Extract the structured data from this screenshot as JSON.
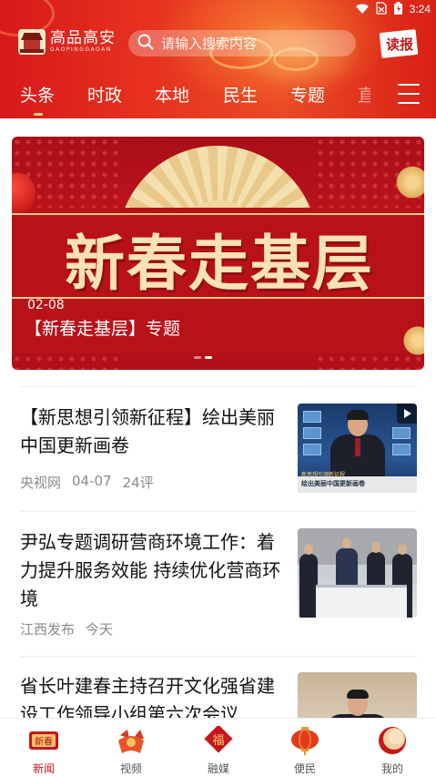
{
  "status_bar": {
    "time": "3:24"
  },
  "header": {
    "logo_cn": "高品高安",
    "logo_en": "GAOPINGGAOAN",
    "search_placeholder": "请输入搜索内容",
    "read_label": "读报",
    "tabs": [
      {
        "label": "头条",
        "active": true
      },
      {
        "label": "时政",
        "active": false
      },
      {
        "label": "本地",
        "active": false
      },
      {
        "label": "民生",
        "active": false
      },
      {
        "label": "专题",
        "active": false
      },
      {
        "label": "直",
        "active": false
      }
    ]
  },
  "banner": {
    "big_text": "新春走基层",
    "date": "02-08",
    "caption": "【新春走基层】专题",
    "slides_total": 2,
    "active_slide": 2
  },
  "articles": [
    {
      "headline": "【新思想引领新征程】绘出美丽中国更新画卷",
      "source": "央视网",
      "date": "04-07",
      "comments": "24评",
      "thumb_top_caption": "新思想引领新征程",
      "thumb_caption": "绘出美丽中国更新画卷",
      "has_video": true
    },
    {
      "headline": "尹弘专题调研营商环境工作：着力提升服务效能 持续优化营商环境",
      "source": "江西发布",
      "date": "今天"
    },
    {
      "headline": "省长叶建春主持召开文化强省建设工作领导小组第六次会议"
    }
  ],
  "bottom_nav": [
    {
      "label": "新闻",
      "icon": "news-icon",
      "icon_text": "新春",
      "active": true
    },
    {
      "label": "视频",
      "icon": "video-icon",
      "active": false
    },
    {
      "label": "融媒",
      "icon": "fu-icon",
      "icon_text": "福",
      "active": false
    },
    {
      "label": "便民",
      "icon": "lantern-icon",
      "active": false
    },
    {
      "label": "我的",
      "icon": "drum-icon",
      "active": false
    }
  ],
  "colors": {
    "brand_red": "#c6171a",
    "header_red": "#e6331f",
    "banner_gold": "#f8e2b6"
  }
}
